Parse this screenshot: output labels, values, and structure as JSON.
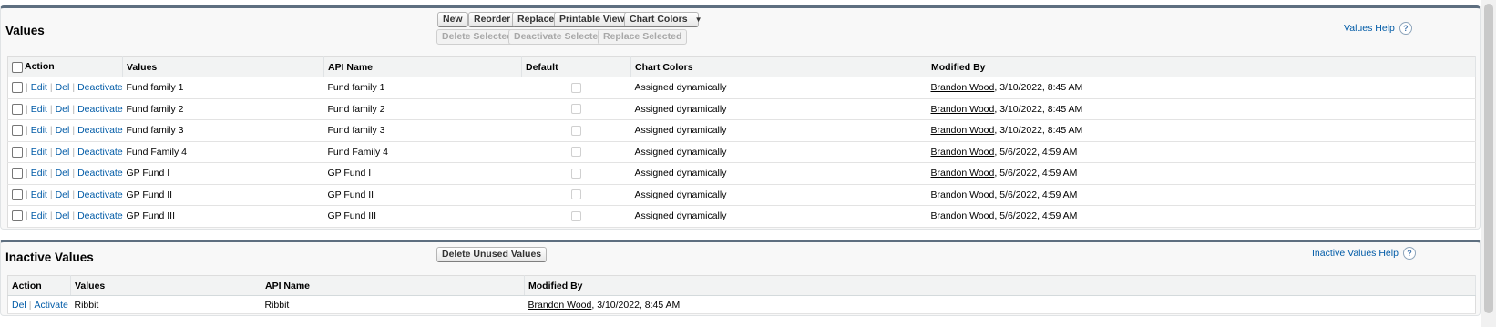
{
  "values_section": {
    "title": "Values",
    "buttons": {
      "new": "New",
      "reorder": "Reorder",
      "replace": "Replace",
      "printable_view": "Printable View",
      "chart_colors": "Chart Colors"
    },
    "selection_buttons": {
      "delete_selected": "Delete Selected",
      "deactivate_selected": "Deactivate Selected",
      "replace_selected": "Replace Selected"
    },
    "help_link": "Values Help",
    "columns": {
      "action": "Action",
      "values": "Values",
      "api_name": "API Name",
      "default": "Default",
      "chart_colors": "Chart Colors",
      "modified_by": "Modified By"
    },
    "row_actions": {
      "edit": "Edit",
      "del": "Del",
      "deactivate": "Deactivate",
      "sep": "|"
    },
    "rows": [
      {
        "value": "Fund family 1",
        "api_name": "Fund family 1",
        "chart_color": "Assigned dynamically",
        "user": "Brandon Wood",
        "modified": ", 3/10/2022, 8:45 AM"
      },
      {
        "value": "Fund family 2",
        "api_name": "Fund family 2",
        "chart_color": "Assigned dynamically",
        "user": "Brandon Wood",
        "modified": ", 3/10/2022, 8:45 AM"
      },
      {
        "value": "Fund family 3",
        "api_name": "Fund family 3",
        "chart_color": "Assigned dynamically",
        "user": "Brandon Wood",
        "modified": ", 3/10/2022, 8:45 AM"
      },
      {
        "value": "Fund Family 4",
        "api_name": "Fund Family 4",
        "chart_color": "Assigned dynamically",
        "user": "Brandon Wood",
        "modified": ", 5/6/2022, 4:59 AM"
      },
      {
        "value": "GP Fund I",
        "api_name": "GP Fund I",
        "chart_color": "Assigned dynamically",
        "user": "Brandon Wood",
        "modified": ", 5/6/2022, 4:59 AM"
      },
      {
        "value": "GP Fund II",
        "api_name": "GP Fund II",
        "chart_color": "Assigned dynamically",
        "user": "Brandon Wood",
        "modified": ", 5/6/2022, 4:59 AM"
      },
      {
        "value": "GP Fund III",
        "api_name": "GP Fund III",
        "chart_color": "Assigned dynamically",
        "user": "Brandon Wood",
        "modified": ", 5/6/2022, 4:59 AM"
      }
    ]
  },
  "inactive_section": {
    "title": "Inactive Values",
    "delete_unused_button": "Delete Unused Values",
    "help_link": "Inactive Values Help",
    "columns": {
      "action": "Action",
      "values": "Values",
      "api_name": "API Name",
      "modified_by": "Modified By"
    },
    "row_actions": {
      "del": "Del",
      "activate": "Activate",
      "sep": "|"
    },
    "rows": [
      {
        "value": "Ribbit",
        "api_name": "Ribbit",
        "user": "Brandon Wood",
        "modified": ", 3/10/2022, 8:45 AM"
      }
    ]
  },
  "help_icon_glyph": "?",
  "dropdown_glyph": "▼"
}
